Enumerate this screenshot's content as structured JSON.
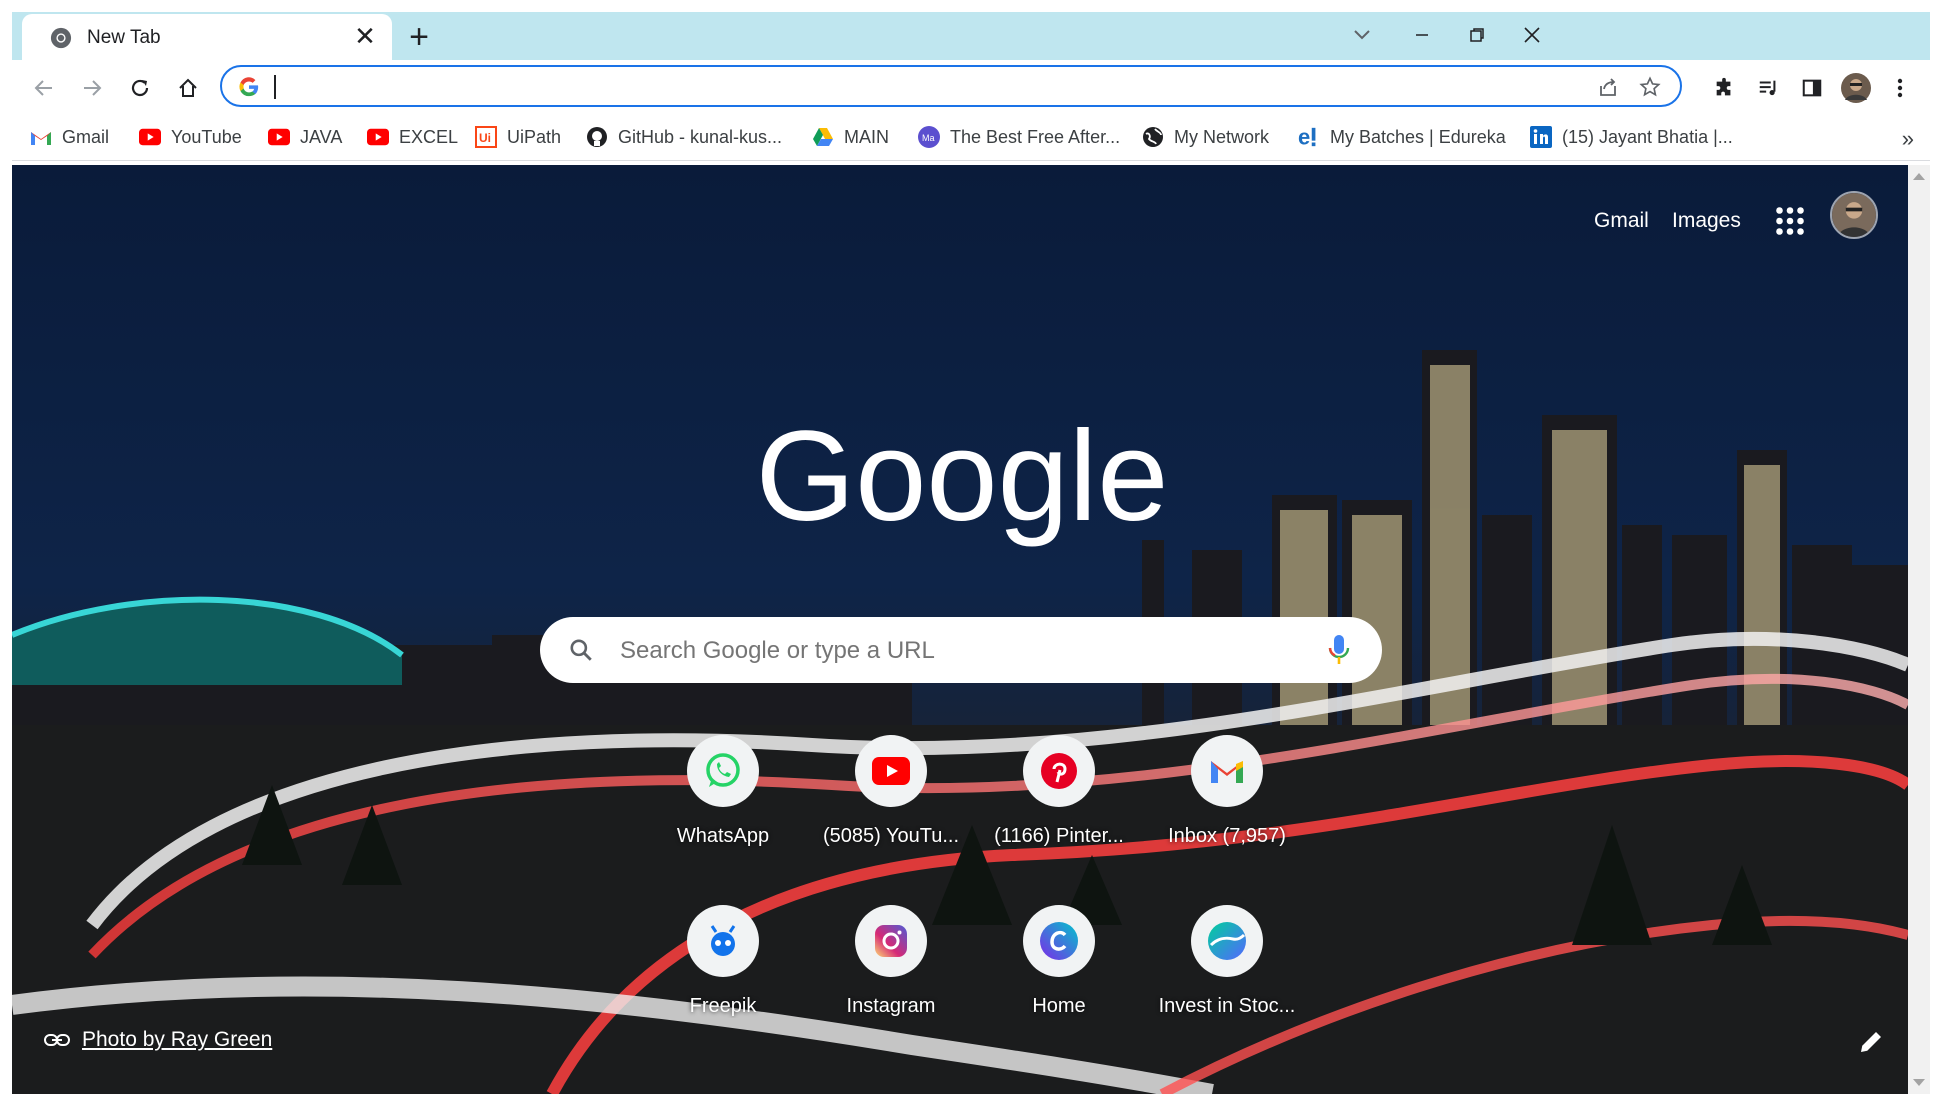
{
  "tab": {
    "title": "New Tab",
    "close": "✕"
  },
  "new_tab_symbol": "+",
  "omnibox": {
    "value": "",
    "placeholder": ""
  },
  "bookmarks": [
    {
      "label": "Gmail",
      "icon": "gmail-icon"
    },
    {
      "label": "YouTube",
      "icon": "youtube-icon"
    },
    {
      "label": "JAVA",
      "icon": "youtube-icon"
    },
    {
      "label": "EXCEL",
      "icon": "youtube-icon"
    },
    {
      "label": "UiPath",
      "icon": "uipath-icon"
    },
    {
      "label": "GitHub - kunal-kus...",
      "icon": "github-icon"
    },
    {
      "label": "MAIN",
      "icon": "drive-icon"
    },
    {
      "label": "The Best Free After...",
      "icon": "ma-icon"
    },
    {
      "label": "My Network",
      "icon": "globe-icon"
    },
    {
      "label": "My Batches | Edureka",
      "icon": "edureka-icon"
    },
    {
      "label": "(15) Jayant Bhatia |...",
      "icon": "linkedin-icon"
    }
  ],
  "bookmarks_more": "»",
  "ntp": {
    "gmail_link": "Gmail",
    "images_link": "Images",
    "logo_text": "Google",
    "search_placeholder": "Search Google or type a URL",
    "shortcuts": [
      {
        "label": "WhatsApp",
        "icon": "whatsapp-icon"
      },
      {
        "label": "(5085) YouTu...",
        "icon": "youtube-icon"
      },
      {
        "label": "(1166) Pinter...",
        "icon": "pinterest-icon"
      },
      {
        "label": "Inbox (7,957)",
        "icon": "gmail-icon"
      },
      {
        "label": "Freepik",
        "icon": "freepik-icon"
      },
      {
        "label": "Instagram",
        "icon": "instagram-icon"
      },
      {
        "label": "Home",
        "icon": "canva-icon"
      },
      {
        "label": "Invest in Stoc...",
        "icon": "invest-icon"
      }
    ],
    "photo_credit": "Photo by Ray Green"
  },
  "colors": {
    "tabstrip": "#bfe6ef",
    "accent": "#1a73e8",
    "sky": "#0d1e3d"
  }
}
